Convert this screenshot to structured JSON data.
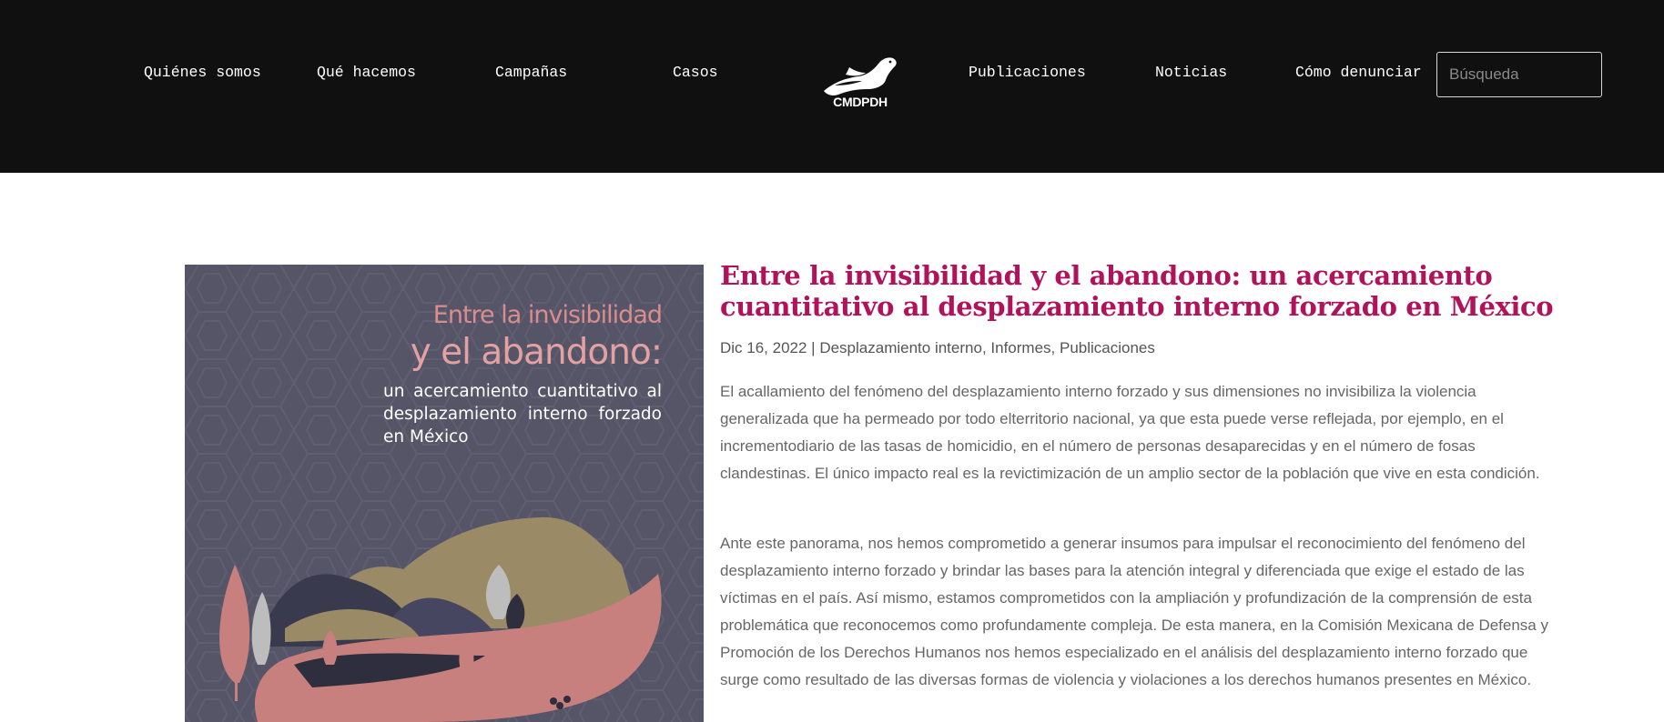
{
  "nav": {
    "items": [
      {
        "label": "Quiénes somos"
      },
      {
        "label": "Qué hacemos"
      },
      {
        "label": "Campañas"
      },
      {
        "label": "Casos"
      },
      {
        "label": "Publicaciones"
      },
      {
        "label": "Noticias"
      },
      {
        "label": "Cómo denunciar"
      }
    ],
    "logo_text": "CMDPDH",
    "search": {
      "placeholder": "Búsqueda",
      "value": ""
    }
  },
  "cover": {
    "title_line1": "Entre la invisibilidad",
    "title_line2": "y el abandono:",
    "subtitle": "un acercamiento cuantitativo al desplazamiento interno forzado en México"
  },
  "post": {
    "title": "Entre la invisibilidad y el abandono: un acercamiento cuantitativo al desplazamiento interno forzado en México",
    "date": "Dic 16, 2022",
    "separator": " | ",
    "categories": [
      "Desplazamiento interno",
      "Informes",
      "Publicaciones"
    ],
    "category_separator": ", ",
    "paragraphs": [
      "El acallamiento del fenómeno del desplazamiento interno forzado y sus dimensiones no invisibiliza la violencia generalizada que ha permeado por todo elterritorio nacional, ya que esta puede verse reflejada, por ejemplo, en el incrementodiario de las tasas de homicidio, en el número de personas desaparecidas y en el número de fosas clandestinas. El único impacto real es la revictimización de un amplio sector de la población que vive en esta condición.",
      "Ante este panorama, nos hemos comprometido a generar insumos para impulsar el reconocimiento del fenómeno del desplazamiento interno forzado y brindar las bases para la atención integral y diferenciada que exige el estado de las víctimas en el país. Así mismo, estamos comprometidos con la ampliación y profundización de la comprensión de esta problemática que reconocemos como profundamente compleja. De esta manera, en la Comisión Mexicana de Defensa y Promoción de los Derechos Humanos nos hemos especializado en el análisis del desplazamiento interno forzado que surge como resultado de las diversas formas de violencia y violaciones a los derechos humanos presentes en México."
    ]
  },
  "colors": {
    "header_bg": "#101010",
    "title_accent": "#b0135a",
    "cover_bg": "#565568",
    "cover_pink": "#d98d8d"
  },
  "icons": {
    "logo": "pelican-logo-icon"
  }
}
